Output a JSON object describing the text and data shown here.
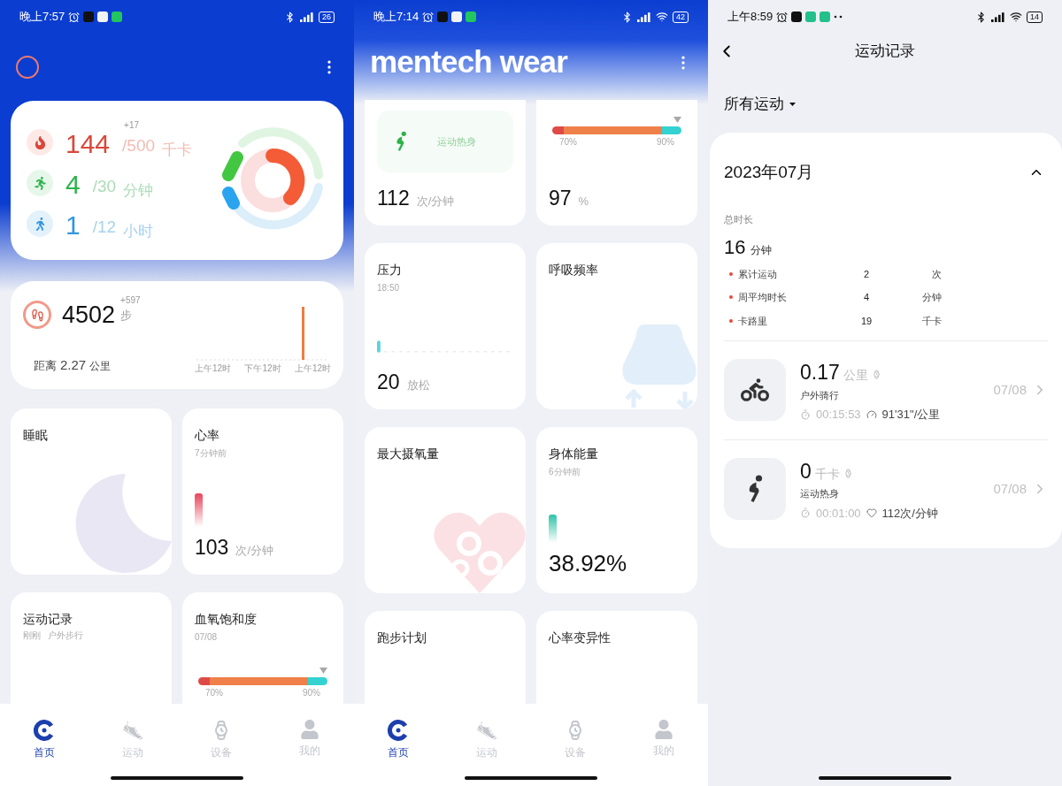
{
  "home_screen": {
    "status_bar": {
      "time": "晚上7:57",
      "battery": "26"
    },
    "activity": {
      "rows": [
        {
          "kind": "calories",
          "value": "144",
          "delta": "+17",
          "goal": "/500",
          "unit": "千卡"
        },
        {
          "kind": "exercise",
          "value": "4",
          "goal": "/30",
          "unit": "分钟"
        },
        {
          "kind": "standing",
          "value": "1",
          "goal": "/12",
          "unit": "小时"
        }
      ]
    },
    "steps": {
      "value": "4502",
      "delta": "+597",
      "unit": "步",
      "distance_label": "距离",
      "distance": "2.27",
      "distance_unit": "公里",
      "axis_labels": [
        "上午12时",
        "下午12时",
        "上午12时"
      ]
    },
    "cards": [
      {
        "kind": "sleep",
        "title": "睡眠"
      },
      {
        "kind": "heart_rate",
        "title": "心率",
        "subtitle": "7分钟前",
        "value": "103",
        "unit": "次/分钟"
      },
      {
        "kind": "workout",
        "title": "运动记录",
        "subtitle": "刚刚",
        "detail": "户外步行"
      },
      {
        "kind": "spo2",
        "title": "血氧饱和度",
        "subtitle": "07/08",
        "level": 0.97,
        "low_label": "70%",
        "high_label": "90%"
      }
    ],
    "tabs": [
      {
        "kind": "home",
        "label": "首页",
        "selected": true
      },
      {
        "kind": "workout",
        "label": "运动",
        "selected": false
      },
      {
        "kind": "device",
        "label": "设备",
        "selected": false
      },
      {
        "kind": "profile",
        "label": "我的",
        "selected": false
      }
    ]
  },
  "home_screen_scrolled": {
    "status_bar": {
      "time": "晚上7:14",
      "battery": "42"
    },
    "logo": "mentech wear",
    "cards": [
      {
        "kind": "workout_live",
        "activity": "运动热身",
        "value": "112",
        "unit": "次/分钟"
      },
      {
        "kind": "spo2",
        "level": 0.97,
        "low_label": "70%",
        "high_label": "90%",
        "value": "97",
        "unit": "%"
      },
      {
        "kind": "stress",
        "title": "压力",
        "subtitle": "18:50",
        "value": "20",
        "unit": "放松"
      },
      {
        "kind": "respiration",
        "title": "呼吸频率"
      },
      {
        "kind": "vo2max",
        "title": "最大摄氧量"
      },
      {
        "kind": "body_energy",
        "title": "身体能量",
        "subtitle": "6分钟前",
        "value": "38.92%"
      },
      {
        "kind": "running_plan",
        "title": "跑步计划"
      },
      {
        "kind": "hrv",
        "title": "心率变异性"
      }
    ],
    "tabs": [
      {
        "kind": "home",
        "label": "首页",
        "selected": true
      },
      {
        "kind": "workout",
        "label": "运动",
        "selected": false
      },
      {
        "kind": "device",
        "label": "设备",
        "selected": false
      },
      {
        "kind": "profile",
        "label": "我的",
        "selected": false
      }
    ]
  },
  "records_screen": {
    "status_bar": {
      "time": "上午8:59",
      "battery": "14"
    },
    "title": "运动记录",
    "filter": "所有运动",
    "month": {
      "label": "2023年07月",
      "expanded": true,
      "total_label": "总时长",
      "total_value": "16",
      "total_unit": "分钟",
      "stats": [
        {
          "label": "累计运动",
          "value": "2",
          "unit": "次"
        },
        {
          "label": "周平均时长",
          "value": "4",
          "unit": "分钟"
        },
        {
          "label": "卡路里",
          "value": "19",
          "unit": "千卡"
        }
      ]
    },
    "records": [
      {
        "kind": "cycling",
        "value": "0.17",
        "unit": "公里",
        "name": "户外骑行",
        "duration": "00:15:53",
        "metric": "91'31\"/公里",
        "date": "07/08"
      },
      {
        "kind": "warmup",
        "value": "0",
        "unit": "千卡",
        "name": "运动热身",
        "duration": "00:01:00",
        "metric": "112次/分钟",
        "date": "07/08"
      }
    ]
  }
}
